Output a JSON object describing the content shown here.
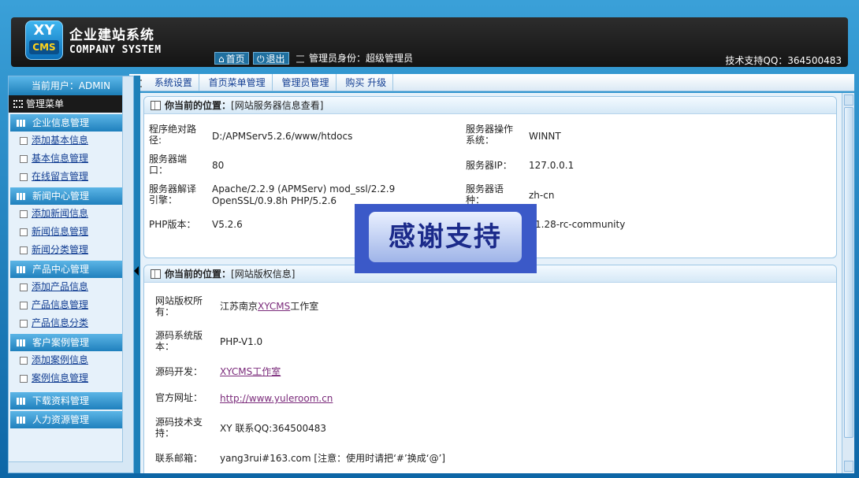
{
  "header": {
    "logo_top": "XY",
    "logo_bottom": "CMS",
    "brand_cn": "企业建站系统",
    "brand_en": "COMPANY SYSTEM",
    "home_label": "首页",
    "logout_label": "退出",
    "admin_identity": "管理员身份：超级管理员",
    "support": "技术支持QQ：364500483"
  },
  "sidebar": {
    "current_user": "当前用户：ADMIN",
    "menu_title": "管理菜单",
    "groups": [
      {
        "label": "企业信息管理",
        "items": [
          "添加基本信息",
          "基本信息管理",
          "在线留言管理"
        ]
      },
      {
        "label": "新闻中心管理",
        "items": [
          "添加新闻信息",
          "新闻信息管理",
          "新闻分类管理"
        ]
      },
      {
        "label": "产品中心管理",
        "items": [
          "添加产品信息",
          "产品信息管理",
          "产品信息分类"
        ]
      },
      {
        "label": "客户案例管理",
        "items": [
          "添加案例信息",
          "案例信息管理"
        ]
      },
      {
        "label": "下载资料管理",
        "items": []
      },
      {
        "label": "人力资源管理",
        "items": []
      }
    ]
  },
  "nav": {
    "items": [
      "系统设置",
      "首页菜单管理",
      "管理员管理",
      "购买 升级"
    ]
  },
  "server_panel": {
    "position_label": "你当前的位置：",
    "position_value": "[网站服务器信息查看]",
    "rows": [
      {
        "label": "程序绝对路径:",
        "value": "D:/APMServ5.2.6/www/htdocs",
        "label2": "服务器操作系统：",
        "value2": "WINNT"
      },
      {
        "label": "服务器端口：",
        "value": "80",
        "label2": "服务器IP：",
        "value2": "127.0.0.1"
      },
      {
        "label": "服务器解译引擎：",
        "value": "Apache/2.2.9 (APMServ) mod_ssl/2.2.9 OpenSSL/0.9.8h PHP/5.2.6",
        "label2": "服务器语种：",
        "value2": "zh-cn"
      },
      {
        "label": "PHP版本：",
        "value": "V5.2.6",
        "label2": "",
        "value2": "1.28-rc-community"
      }
    ]
  },
  "copyright_panel": {
    "position_label": "你当前的位置：",
    "position_value": "[网站版权信息]",
    "rows": [
      {
        "label": "网站版权所有：",
        "prefix": "江苏南京",
        "link": "XYCMS",
        "suffix": "工作室"
      },
      {
        "label": "源码系统版本：",
        "value": "PHP-V1.0"
      },
      {
        "label": "源码开发：",
        "link": "XYCMS工作室"
      },
      {
        "label": "官方网址：",
        "link": "http://www.yuleroom.cn"
      },
      {
        "label": "源码技术支持：",
        "value": "XY  联系QQ:364500483"
      },
      {
        "label": "联系邮箱：",
        "value": "yang3rui#163.com [注意：使用时请把‘#’换成‘@’]"
      }
    ]
  },
  "overlay": {
    "text": "感谢支持"
  }
}
